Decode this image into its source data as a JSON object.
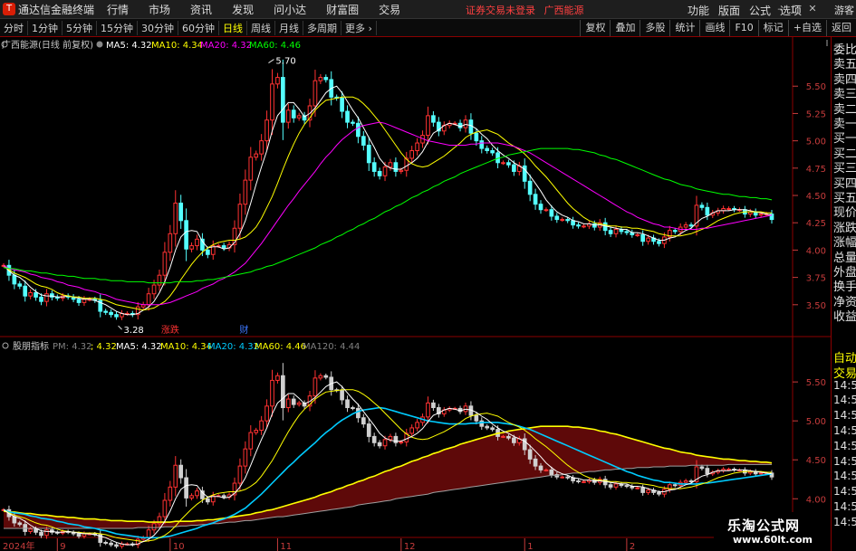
{
  "titlebar": {
    "app_title": "通达信金融终端",
    "menus": [
      "行情",
      "市场",
      "资讯",
      "发现",
      "问小达",
      "财富圈",
      "交易"
    ],
    "broker_status": "证券交易未登录",
    "stock_name": "广西能源",
    "right_menus": [
      "功能",
      "版面",
      "公式",
      "选项"
    ],
    "guest": "游客",
    "logo_letter": "T",
    "corner_letter": "R"
  },
  "toolbar": {
    "periods": [
      "分时",
      "1分钟",
      "5分钟",
      "15分钟",
      "30分钟",
      "60分钟",
      "日线",
      "周线",
      "月线",
      "多周期",
      "更多"
    ],
    "active_period": "日线",
    "right_buttons": [
      "复权",
      "叠加",
      "多股",
      "统计",
      "画线",
      "F10",
      "标记",
      "+自选",
      "返回"
    ]
  },
  "upper_panel": {
    "title": "广西能源(日线 前复权)",
    "legend": [
      {
        "label": "MA5: 4.32",
        "color": "#ffffff"
      },
      {
        "label": "MA10: 4.34",
        "color": "#ffff00"
      },
      {
        "label": "MA20: 4.32",
        "color": "#ff00ff"
      },
      {
        "label": "MA60: 4.46",
        "color": "#00ff00"
      }
    ],
    "high_marker": "5.70",
    "low_marker": "3.28",
    "markers": [
      "涨跌",
      "财"
    ]
  },
  "lower_panel": {
    "title": "股朋指标",
    "legend": [
      {
        "label": "PM: 4.32",
        "color": "#808080"
      },
      {
        "label": "; 4.32",
        "color": "#ffff00"
      },
      {
        "label": "MA5: 4.32",
        "color": "#ffffff"
      },
      {
        "label": "MA10: 4.34",
        "color": "#ffff00"
      },
      {
        "label": "MA20: 4.32",
        "color": "#00ccff"
      },
      {
        "label": "MA60: 4.46",
        "color": "#ffff00"
      },
      {
        "label": "MA120: 4.44",
        "color": "#808080"
      }
    ]
  },
  "time_axis": [
    "2024年",
    "9",
    "10",
    "11",
    "12",
    "1",
    "2"
  ],
  "sidebar": {
    "upper": [
      "委比",
      "卖五",
      "卖四",
      "卖三",
      "卖二",
      "卖一",
      "买一",
      "买二",
      "买三",
      "买四",
      "买五",
      "现价",
      "涨跌",
      "涨幅",
      "总量",
      "外盘",
      "换手",
      "净资",
      "收益"
    ],
    "lower": [
      "自动",
      "交易",
      "14:56",
      "14:56",
      "14:56",
      "14:56",
      "14:56",
      "14:56",
      "14:56",
      "14:56",
      "14:56",
      "14:56"
    ]
  },
  "watermark": {
    "line1": "乐淘公式网",
    "line2": "www.60lt.com"
  },
  "chart_data": {
    "type": "candlestick",
    "y_ticks_upper": [
      3.5,
      3.75,
      4.0,
      4.25,
      4.5,
      4.75,
      5.0,
      5.25,
      5.5
    ],
    "y_ticks_lower": [
      4.0,
      4.5,
      5.0,
      5.5
    ],
    "upper_ylim": [
      3.25,
      5.8
    ],
    "lower_ylim": [
      3.55,
      5.85
    ],
    "n_bars": 144,
    "month_index": {
      "9": 10,
      "10": 31,
      "11": 51,
      "12": 74,
      "1": 97,
      "2": 116
    },
    "close": [
      3.86,
      3.77,
      3.69,
      3.67,
      3.58,
      3.61,
      3.57,
      3.53,
      3.6,
      3.57,
      3.56,
      3.58,
      3.57,
      3.55,
      3.52,
      3.55,
      3.55,
      3.54,
      3.44,
      3.43,
      3.41,
      3.39,
      3.42,
      3.42,
      3.41,
      3.48,
      3.5,
      3.6,
      3.68,
      3.77,
      3.98,
      4.15,
      4.43,
      4.27,
      4.01,
      4.04,
      4.1,
      4.0,
      3.96,
      4.04,
      4.04,
      4.02,
      4.05,
      4.2,
      4.42,
      4.64,
      4.85,
      4.88,
      5.0,
      5.19,
      5.52,
      5.58,
      5.17,
      5.28,
      5.21,
      5.23,
      5.19,
      5.32,
      5.55,
      5.58,
      5.56,
      5.4,
      5.39,
      5.27,
      5.17,
      5.16,
      5.04,
      4.96,
      4.8,
      4.72,
      4.68,
      4.76,
      4.8,
      4.72,
      4.73,
      4.84,
      4.91,
      4.98,
      5.05,
      5.23,
      5.17,
      5.09,
      5.14,
      5.16,
      5.16,
      5.12,
      5.19,
      5.07,
      5.0,
      4.93,
      4.91,
      4.89,
      4.8,
      4.8,
      4.78,
      4.72,
      4.77,
      4.63,
      4.51,
      4.42,
      4.37,
      4.37,
      4.31,
      4.28,
      4.28,
      4.27,
      4.23,
      4.22,
      4.22,
      4.24,
      4.21,
      4.25,
      4.18,
      4.15,
      4.19,
      4.17,
      4.16,
      4.14,
      4.14,
      4.08,
      4.11,
      4.08,
      4.06,
      4.12,
      4.18,
      4.17,
      4.21,
      4.23,
      4.22,
      4.41,
      4.39,
      4.32,
      4.34,
      4.36,
      4.38,
      4.38,
      4.37,
      4.37,
      4.33,
      4.35,
      4.32,
      4.33,
      4.33,
      4.28
    ],
    "ma5": [
      3.86,
      3.81,
      3.77,
      3.75,
      3.71,
      3.66,
      3.62,
      3.59,
      3.58,
      3.58,
      3.57,
      3.57,
      3.58,
      3.57,
      3.56,
      3.55,
      3.55,
      3.54,
      3.52,
      3.5,
      3.47,
      3.44,
      3.42,
      3.41,
      3.41,
      3.42,
      3.45,
      3.48,
      3.53,
      3.61,
      3.71,
      3.84,
      4.0,
      4.12,
      4.17,
      4.18,
      4.17,
      4.08,
      4.02,
      4.03,
      4.03,
      4.01,
      4.02,
      4.07,
      4.15,
      4.27,
      4.43,
      4.6,
      4.76,
      4.91,
      5.09,
      5.23,
      5.29,
      5.35,
      5.35,
      5.29,
      5.22,
      5.25,
      5.3,
      5.37,
      5.44,
      5.48,
      5.5,
      5.44,
      5.36,
      5.28,
      5.21,
      5.12,
      5.03,
      4.94,
      4.84,
      4.78,
      4.75,
      4.74,
      4.74,
      4.77,
      4.8,
      4.84,
      4.9,
      4.99,
      5.07,
      5.1,
      5.14,
      5.16,
      5.15,
      5.13,
      5.15,
      5.14,
      5.11,
      5.06,
      5.02,
      4.96,
      4.91,
      4.87,
      4.84,
      4.8,
      4.77,
      4.74,
      4.68,
      4.61,
      4.54,
      4.46,
      4.4,
      4.35,
      4.32,
      4.3,
      4.27,
      4.26,
      4.24,
      4.24,
      4.23,
      4.23,
      4.22,
      4.21,
      4.2,
      4.19,
      4.19,
      4.16,
      4.16,
      4.15,
      4.13,
      4.11,
      4.09,
      4.09,
      4.11,
      4.12,
      4.15,
      4.18,
      4.2,
      4.25,
      4.29,
      4.31,
      4.34,
      4.36,
      4.36,
      4.36,
      4.37,
      4.37,
      4.37,
      4.36,
      4.35,
      4.34,
      4.33,
      4.32
    ],
    "ma10": [
      3.86,
      3.82,
      3.79,
      3.77,
      3.75,
      3.72,
      3.69,
      3.67,
      3.66,
      3.64,
      3.61,
      3.59,
      3.58,
      3.57,
      3.57,
      3.56,
      3.56,
      3.56,
      3.55,
      3.54,
      3.52,
      3.5,
      3.49,
      3.48,
      3.47,
      3.46,
      3.45,
      3.46,
      3.47,
      3.5,
      3.53,
      3.58,
      3.65,
      3.73,
      3.8,
      3.87,
      3.93,
      3.98,
      4.02,
      4.05,
      4.07,
      4.08,
      4.09,
      4.09,
      4.1,
      4.12,
      4.16,
      4.21,
      4.29,
      4.39,
      4.49,
      4.61,
      4.74,
      4.86,
      4.97,
      5.07,
      5.15,
      5.21,
      5.28,
      5.33,
      5.37,
      5.38,
      5.39,
      5.4,
      5.4,
      5.4,
      5.38,
      5.34,
      5.29,
      5.23,
      5.17,
      5.1,
      5.03,
      4.96,
      4.89,
      4.83,
      4.79,
      4.77,
      4.76,
      4.77,
      4.8,
      4.83,
      4.86,
      4.9,
      4.94,
      4.98,
      5.03,
      5.06,
      5.08,
      5.09,
      5.1,
      5.08,
      5.06,
      5.02,
      4.98,
      4.95,
      4.92,
      4.88,
      4.83,
      4.77,
      4.72,
      4.67,
      4.61,
      4.55,
      4.49,
      4.43,
      4.38,
      4.34,
      4.3,
      4.27,
      4.25,
      4.24,
      4.23,
      4.22,
      4.22,
      4.21,
      4.21,
      4.2,
      4.2,
      4.19,
      4.18,
      4.17,
      4.15,
      4.14,
      4.13,
      4.13,
      4.13,
      4.14,
      4.15,
      4.17,
      4.19,
      4.21,
      4.24,
      4.27,
      4.29,
      4.31,
      4.33,
      4.34,
      4.35,
      4.35,
      4.35,
      4.35,
      4.34,
      4.34
    ],
    "ma20": [
      3.86,
      3.83,
      3.82,
      3.81,
      3.8,
      3.78,
      3.77,
      3.75,
      3.74,
      3.73,
      3.71,
      3.7,
      3.68,
      3.67,
      3.66,
      3.64,
      3.63,
      3.62,
      3.6,
      3.59,
      3.57,
      3.55,
      3.54,
      3.53,
      3.52,
      3.51,
      3.5,
      3.5,
      3.5,
      3.5,
      3.51,
      3.52,
      3.54,
      3.56,
      3.58,
      3.6,
      3.62,
      3.65,
      3.67,
      3.69,
      3.72,
      3.74,
      3.77,
      3.8,
      3.84,
      3.88,
      3.94,
      4.0,
      4.06,
      4.13,
      4.2,
      4.27,
      4.34,
      4.41,
      4.47,
      4.54,
      4.6,
      4.66,
      4.72,
      4.79,
      4.85,
      4.9,
      4.96,
      5.01,
      5.05,
      5.09,
      5.12,
      5.14,
      5.15,
      5.16,
      5.17,
      5.16,
      5.14,
      5.12,
      5.1,
      5.08,
      5.06,
      5.04,
      5.02,
      5.0,
      4.99,
      4.98,
      4.97,
      4.96,
      4.96,
      4.96,
      4.96,
      4.97,
      4.97,
      4.98,
      4.98,
      4.98,
      4.98,
      4.97,
      4.96,
      4.95,
      4.93,
      4.91,
      4.89,
      4.86,
      4.83,
      4.8,
      4.77,
      4.74,
      4.71,
      4.68,
      4.65,
      4.62,
      4.59,
      4.56,
      4.53,
      4.5,
      4.47,
      4.44,
      4.41,
      4.38,
      4.35,
      4.33,
      4.3,
      4.28,
      4.26,
      4.24,
      4.23,
      4.21,
      4.21,
      4.2,
      4.19,
      4.19,
      4.19,
      4.19,
      4.2,
      4.2,
      4.21,
      4.22,
      4.23,
      4.24,
      4.25,
      4.26,
      4.27,
      4.28,
      4.29,
      4.3,
      4.31,
      4.32
    ],
    "ma60": [
      3.84,
      3.83,
      3.83,
      3.82,
      3.81,
      3.81,
      3.8,
      3.79,
      3.79,
      3.78,
      3.77,
      3.77,
      3.76,
      3.76,
      3.75,
      3.74,
      3.74,
      3.74,
      3.73,
      3.73,
      3.72,
      3.72,
      3.72,
      3.71,
      3.71,
      3.71,
      3.71,
      3.7,
      3.7,
      3.7,
      3.7,
      3.7,
      3.71,
      3.71,
      3.71,
      3.71,
      3.72,
      3.72,
      3.73,
      3.73,
      3.74,
      3.75,
      3.76,
      3.77,
      3.78,
      3.79,
      3.8,
      3.82,
      3.83,
      3.85,
      3.86,
      3.88,
      3.9,
      3.92,
      3.94,
      3.96,
      3.98,
      4.0,
      4.02,
      4.05,
      4.07,
      4.09,
      4.12,
      4.14,
      4.17,
      4.19,
      4.22,
      4.24,
      4.27,
      4.29,
      4.32,
      4.35,
      4.37,
      4.4,
      4.42,
      4.45,
      4.48,
      4.5,
      4.53,
      4.55,
      4.58,
      4.6,
      4.63,
      4.65,
      4.67,
      4.7,
      4.72,
      4.74,
      4.76,
      4.78,
      4.8,
      4.82,
      4.84,
      4.85,
      4.87,
      4.88,
      4.89,
      4.9,
      4.91,
      4.92,
      4.93,
      4.93,
      4.93,
      4.93,
      4.93,
      4.93,
      4.92,
      4.92,
      4.91,
      4.9,
      4.89,
      4.87,
      4.86,
      4.84,
      4.83,
      4.81,
      4.79,
      4.77,
      4.75,
      4.73,
      4.71,
      4.69,
      4.67,
      4.65,
      4.64,
      4.62,
      4.6,
      4.59,
      4.58,
      4.56,
      4.55,
      4.54,
      4.53,
      4.52,
      4.51,
      4.51,
      4.5,
      4.49,
      4.49,
      4.48,
      4.48,
      4.47,
      4.47,
      4.46
    ],
    "ma120": [
      3.62,
      3.62,
      3.62,
      3.62,
      3.62,
      3.62,
      3.62,
      3.62,
      3.62,
      3.62,
      3.62,
      3.62,
      3.62,
      3.62,
      3.62,
      3.62,
      3.62,
      3.62,
      3.62,
      3.62,
      3.62,
      3.62,
      3.62,
      3.62,
      3.62,
      3.63,
      3.63,
      3.63,
      3.63,
      3.63,
      3.64,
      3.64,
      3.64,
      3.65,
      3.65,
      3.66,
      3.66,
      3.67,
      3.67,
      3.68,
      3.68,
      3.69,
      3.7,
      3.7,
      3.71,
      3.72,
      3.72,
      3.73,
      3.74,
      3.75,
      3.76,
      3.77,
      3.77,
      3.78,
      3.79,
      3.8,
      3.81,
      3.82,
      3.83,
      3.84,
      3.85,
      3.86,
      3.87,
      3.88,
      3.89,
      3.9,
      3.92,
      3.93,
      3.94,
      3.95,
      3.96,
      3.97,
      3.98,
      4.0,
      4.01,
      4.02,
      4.03,
      4.04,
      4.05,
      4.06,
      4.08,
      4.09,
      4.1,
      4.11,
      4.12,
      4.13,
      4.14,
      4.15,
      4.16,
      4.17,
      4.18,
      4.19,
      4.2,
      4.21,
      4.22,
      4.23,
      4.24,
      4.25,
      4.26,
      4.27,
      4.28,
      4.29,
      4.3,
      4.3,
      4.31,
      4.32,
      4.33,
      4.33,
      4.34,
      4.35,
      4.35,
      4.36,
      4.37,
      4.37,
      4.38,
      4.38,
      4.39,
      4.39,
      4.4,
      4.4,
      4.4,
      4.41,
      4.41,
      4.41,
      4.42,
      4.42,
      4.42,
      4.42,
      4.43,
      4.43,
      4.43,
      4.43,
      4.43,
      4.43,
      4.43,
      4.44,
      4.44,
      4.44,
      4.44,
      4.44,
      4.44,
      4.44,
      4.44,
      4.44
    ]
  }
}
